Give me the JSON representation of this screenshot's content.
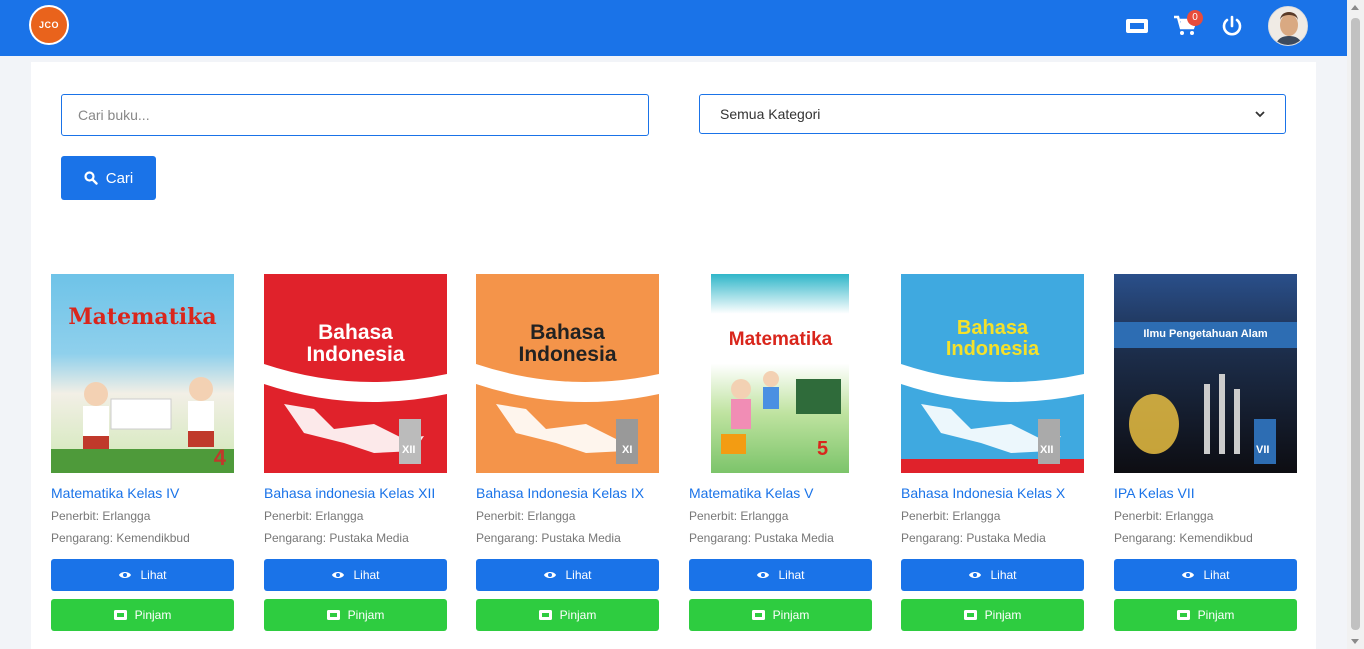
{
  "navbar": {
    "logo_text": "JCO",
    "cart_count": "0",
    "icons": [
      "ticket-icon",
      "cart-icon",
      "power-icon"
    ]
  },
  "search": {
    "placeholder": "Cari buku...",
    "value": ""
  },
  "category": {
    "selected": "Semua Kategori"
  },
  "search_button": {
    "label": "Cari",
    "icon": "search-icon"
  },
  "colors": {
    "primary": "#1a73e8",
    "success": "#2ecc40"
  },
  "books": [
    {
      "title": "Matematika Kelas IV",
      "publisher": "Penerbit: Erlangga",
      "author": "Pengarang: Kemendikbud",
      "cover_title": "Matematika",
      "cover_grade": "4",
      "view_label": "Lihat",
      "borrow_label": "Pinjam"
    },
    {
      "title": "Bahasa indonesia Kelas XII",
      "publisher": "Penerbit: Erlangga",
      "author": "Pengarang: Pustaka Media",
      "cover_title": "Bahasa Indonesia",
      "cover_grade": "XII",
      "view_label": "Lihat",
      "borrow_label": "Pinjam"
    },
    {
      "title": "Bahasa Indonesia Kelas IX",
      "publisher": "Penerbit: Erlangga",
      "author": "Pengarang: Pustaka Media",
      "cover_title": "Bahasa Indonesia",
      "cover_grade": "XI",
      "view_label": "Lihat",
      "borrow_label": "Pinjam"
    },
    {
      "title": "Matematika Kelas V",
      "publisher": "Penerbit: Erlangga",
      "author": "Pengarang: Pustaka Media",
      "cover_title": "Matematika",
      "cover_grade": "5",
      "view_label": "Lihat",
      "borrow_label": "Pinjam"
    },
    {
      "title": "Bahasa Indonesia Kelas X",
      "publisher": "Penerbit: Erlangga",
      "author": "Pengarang: Pustaka Media",
      "cover_title": "Bahasa Indonesia",
      "cover_grade": "XII",
      "view_label": "Lihat",
      "borrow_label": "Pinjam"
    },
    {
      "title": "IPA Kelas VII",
      "publisher": "Penerbit: Erlangga",
      "author": "Pengarang: Kemendikbud",
      "cover_title": "Ilmu Pengetahuan Alam",
      "cover_grade": "VII",
      "view_label": "Lihat",
      "borrow_label": "Pinjam"
    }
  ]
}
